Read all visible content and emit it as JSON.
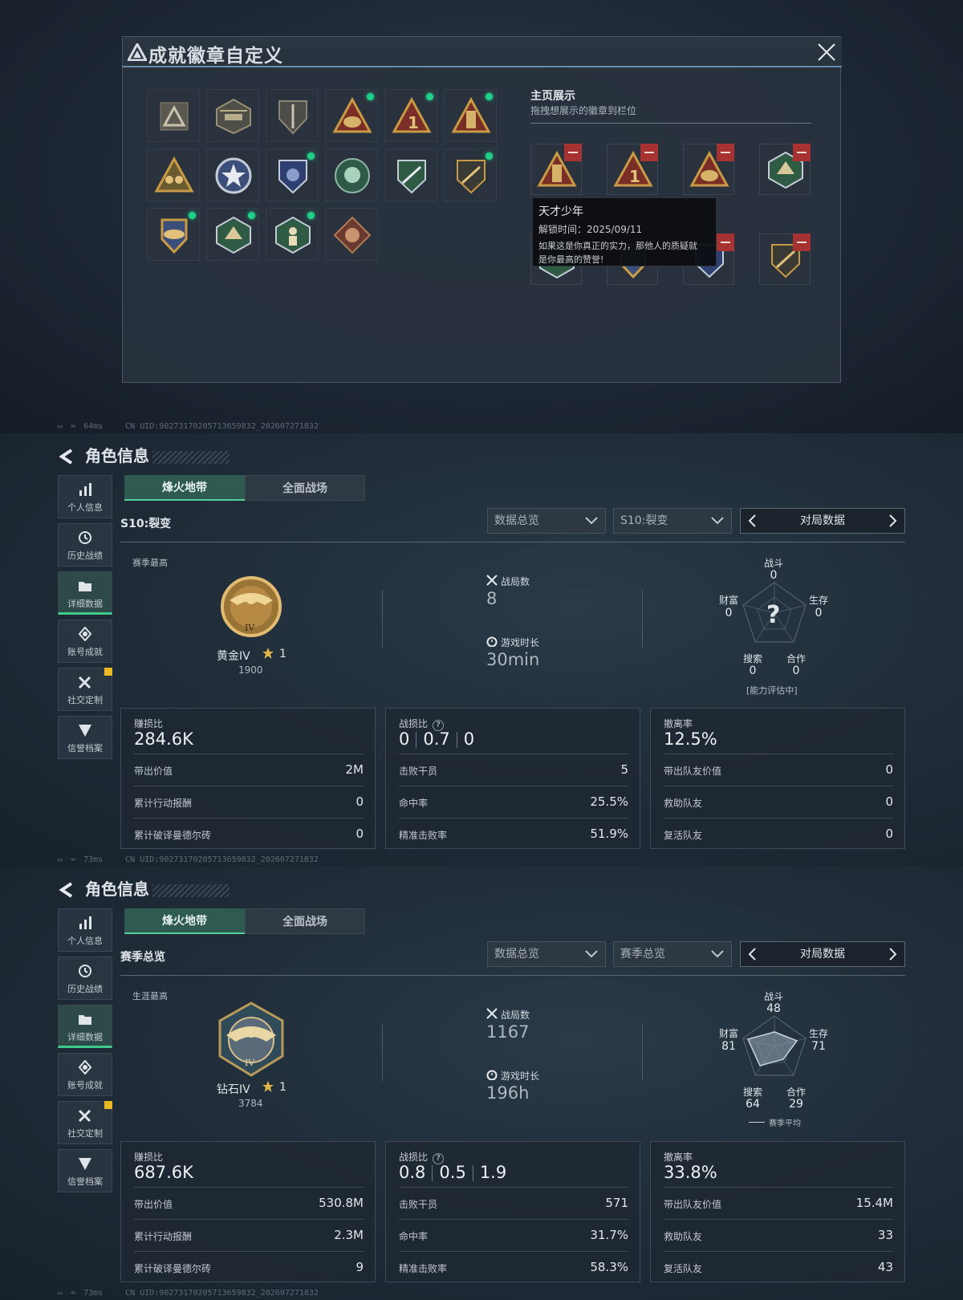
{
  "dialog": {
    "title": "成就徽章自定义",
    "display_title": "主页展示",
    "display_subtitle": "拖拽想展示的徽章到栏位",
    "tooltip": {
      "name": "天才少年",
      "unlock": "解锁时间：2025/09/11",
      "desc_line1": "如果这是你真正的实力，那他人的质疑就",
      "desc_line2": "是你最高的赞誉!"
    }
  },
  "status1": {
    "ping": "64ms",
    "uid": "CN UID:9027317020571365983​2_202607271832"
  },
  "status2": {
    "ping": "73ms",
    "uid": "CN UID:9027317020571365983​2_202607271832"
  },
  "status3": {
    "ping": "73ms",
    "uid": "CN UID:9027317020571365983​2_202607271832"
  },
  "sidebar": {
    "items": [
      {
        "label": "个人信息"
      },
      {
        "label": "历史战绩"
      },
      {
        "label": "详细数据"
      },
      {
        "label": "账号成就"
      },
      {
        "label": "社交定制"
      },
      {
        "label": "信誉档案"
      }
    ]
  },
  "page_title": "角色信息",
  "tabs": {
    "t1": "烽火地带",
    "t2": "全面战场"
  },
  "p1": {
    "season": "S10:裂变",
    "dd1": "数据总览",
    "dd2": "S10:裂变",
    "match_data": "对局数据",
    "best_label": "赛季最高",
    "rank_name": "黄金IV",
    "rank_star": "1",
    "rank_points": "1900",
    "matches_label": "战局数",
    "matches": "8",
    "time_label": "游戏时长",
    "time": "30min",
    "radar": {
      "combat_l": "战斗",
      "combat": "0",
      "survive_l": "生存",
      "survive": "0",
      "coop_l": "合作",
      "coop": "0",
      "search_l": "搜索",
      "search": "0",
      "wealth_l": "财富",
      "wealth": "0",
      "note": "[能力评估中]"
    },
    "card1": {
      "title": "赚损比",
      "value": "284.6K",
      "rows": [
        {
          "k": "带出价值",
          "v": "2M"
        },
        {
          "k": "累计行动报酬",
          "v": "0"
        },
        {
          "k": "累计破译曼德尔砖",
          "v": "0"
        }
      ]
    },
    "card2": {
      "title": "战损比",
      "r1": "0",
      "r2": "0.7",
      "r3": "0",
      "rows": [
        {
          "k": "击败干员",
          "v": "5"
        },
        {
          "k": "命中率",
          "v": "25.5%"
        },
        {
          "k": "精准击败率",
          "v": "51.9%"
        }
      ]
    },
    "card3": {
      "title": "撤离率",
      "value": "12.5%",
      "rows": [
        {
          "k": "带出队友价值",
          "v": "0"
        },
        {
          "k": "救助队友",
          "v": "0"
        },
        {
          "k": "复活队友",
          "v": "0"
        }
      ]
    }
  },
  "p2": {
    "season": "赛季总览",
    "dd1": "数据总览",
    "dd2": "赛季总览",
    "match_data": "对局数据",
    "best_label": "生涯最高",
    "rank_name": "钻石IV",
    "rank_star": "1",
    "rank_points": "3784",
    "matches_label": "战局数",
    "matches": "1167",
    "time_label": "游戏时长",
    "time": "196h",
    "radar": {
      "combat_l": "战斗",
      "combat": "48",
      "survive_l": "生存",
      "survive": "71",
      "coop_l": "合作",
      "coop": "29",
      "search_l": "搜索",
      "search": "64",
      "wealth_l": "财富",
      "wealth": "81",
      "note": "赛季平均"
    },
    "card1": {
      "title": "赚损比",
      "value": "687.6K",
      "rows": [
        {
          "k": "带出价值",
          "v": "530.8M"
        },
        {
          "k": "累计行动报酬",
          "v": "2.3M"
        },
        {
          "k": "累计破译曼德尔砖",
          "v": "9"
        }
      ]
    },
    "card2": {
      "title": "战损比",
      "r1": "0.8",
      "r2": "0.5",
      "r3": "1.9",
      "rows": [
        {
          "k": "击败干员",
          "v": "571"
        },
        {
          "k": "命中率",
          "v": "31.7%"
        },
        {
          "k": "精准击败率",
          "v": "58.3%"
        }
      ]
    },
    "card3": {
      "title": "撤离率",
      "value": "33.8%",
      "rows": [
        {
          "k": "带出队友价值",
          "v": "15.4M"
        },
        {
          "k": "救助队友",
          "v": "33"
        },
        {
          "k": "复活队友",
          "v": "43"
        }
      ]
    }
  },
  "colors": {
    "accent": "#3fc98d",
    "new_dot": "#1fd08a",
    "remove": "#a63232",
    "gold": "#c99a45"
  }
}
